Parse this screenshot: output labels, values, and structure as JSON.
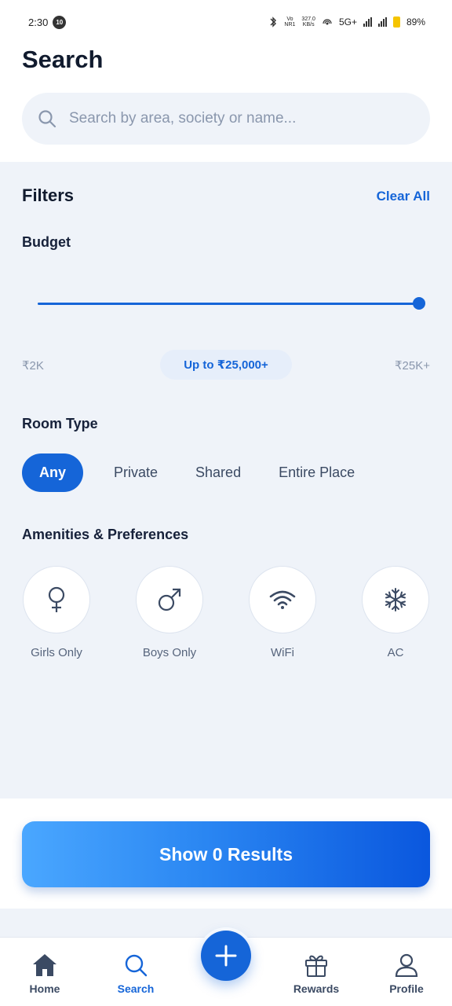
{
  "status_bar": {
    "time": "2:30",
    "notification_badge": "10",
    "network_top": "Vo",
    "network_bottom": "NR1",
    "speed_top": "327.0",
    "speed_bottom": "KB/s",
    "network_type": "5G+",
    "battery": "89%"
  },
  "header": {
    "title": "Search",
    "search_placeholder": "Search by area, society or name..."
  },
  "filters": {
    "title": "Filters",
    "clear_all": "Clear All",
    "budget": {
      "label": "Budget",
      "min_label": "₹2K",
      "max_label": "₹25K+",
      "selected_label": "Up to ₹25,000+",
      "min_value": 2000,
      "max_value": 25000,
      "selected_value": 25000
    },
    "room_type": {
      "label": "Room Type",
      "options": [
        "Any",
        "Private",
        "Shared",
        "Entire Place"
      ],
      "selected": "Any"
    },
    "amenities": {
      "label": "Amenities & Preferences",
      "items": [
        {
          "label": "Girls Only",
          "icon": "female-icon"
        },
        {
          "label": "Boys Only",
          "icon": "male-icon"
        },
        {
          "label": "WiFi",
          "icon": "wifi-icon"
        },
        {
          "label": "AC",
          "icon": "snowflake-icon"
        }
      ]
    }
  },
  "results_button": "Show 0 Results",
  "bottom_nav": {
    "items": [
      {
        "label": "Home",
        "icon": "home-icon"
      },
      {
        "label": "Search",
        "icon": "search-icon",
        "active": true
      },
      {
        "label": "Rewards",
        "icon": "gift-icon"
      },
      {
        "label": "Profile",
        "icon": "user-icon"
      }
    ],
    "fab_icon": "plus-icon"
  },
  "colors": {
    "accent": "#1565d8",
    "panel_bg": "#eff3f9",
    "text_dark": "#111b2e",
    "text_muted": "#8a97ad"
  }
}
